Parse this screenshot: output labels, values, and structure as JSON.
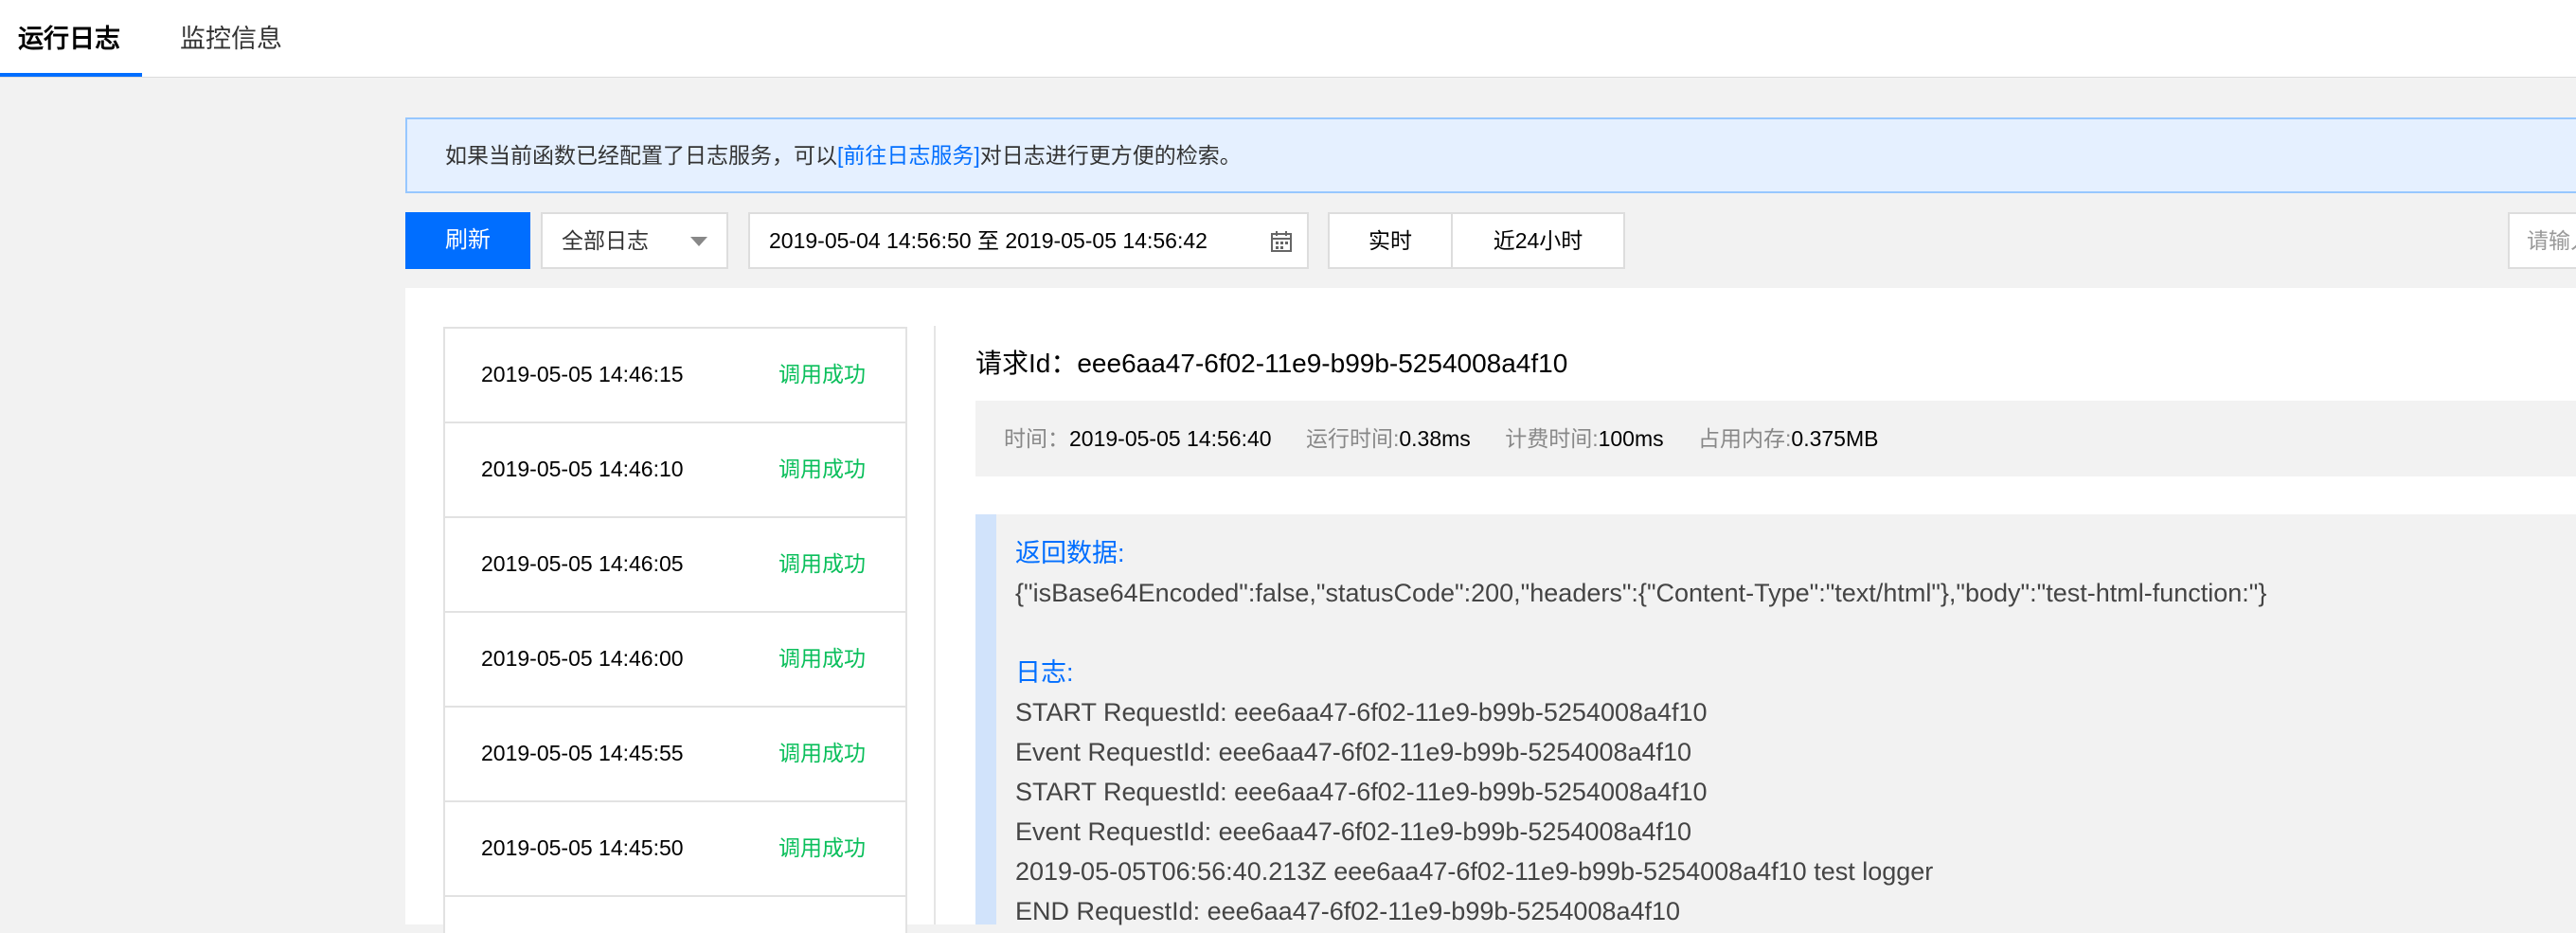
{
  "tabs": [
    {
      "label": "运行日志",
      "active": true
    },
    {
      "label": "监控信息",
      "active": false
    }
  ],
  "banner": {
    "prefix": "如果当前函数已经配置了日志服务，可以",
    "link": "[前往日志服务]",
    "suffix": "对日志进行更方便的检索。"
  },
  "toolbar": {
    "refresh_label": "刷新",
    "log_filter": "全部日志",
    "date_range": "2019-05-04 14:56:50 至 2019-05-05 14:56:42",
    "realtime_label": "实时",
    "last24h_label": "近24小时",
    "search_placeholder": "请输入"
  },
  "log_list": [
    {
      "time": "2019-05-05 14:46:15",
      "status": "调用成功"
    },
    {
      "time": "2019-05-05 14:46:10",
      "status": "调用成功"
    },
    {
      "time": "2019-05-05 14:46:05",
      "status": "调用成功"
    },
    {
      "time": "2019-05-05 14:46:00",
      "status": "调用成功"
    },
    {
      "time": "2019-05-05 14:45:55",
      "status": "调用成功"
    },
    {
      "time": "2019-05-05 14:45:50",
      "status": "调用成功"
    }
  ],
  "detail": {
    "request_label": "请求Id：",
    "request_id": "eee6aa47-6f02-11e9-b99b-5254008a4f10",
    "meta": {
      "time_label": "时间：",
      "time_value": "2019-05-05 14:56:40",
      "run_label": "运行时间:",
      "run_value": "0.38ms",
      "bill_label": "计费时间:",
      "bill_value": "100ms",
      "mem_label": "占用内存:",
      "mem_value": "0.375MB"
    },
    "return_label": "返回数据:",
    "return_value": "{\"isBase64Encoded\":false,\"statusCode\":200,\"headers\":{\"Content-Type\":\"text/html\"},\"body\":\"test-html-function:\"}",
    "log_label": "日志:",
    "log_lines": [
      "START RequestId: eee6aa47-6f02-11e9-b99b-5254008a4f10",
      "Event RequestId: eee6aa47-6f02-11e9-b99b-5254008a4f10",
      "START RequestId: eee6aa47-6f02-11e9-b99b-5254008a4f10",
      "Event RequestId: eee6aa47-6f02-11e9-b99b-5254008a4f10",
      "2019-05-05T06:56:40.213Z eee6aa47-6f02-11e9-b99b-5254008a4f10 test logger",
      "END RequestId: eee6aa47-6f02-11e9-b99b-5254008a4f10"
    ]
  },
  "colors": {
    "accent": "#006eff",
    "success": "#0abf5b",
    "banner_bg": "#e5f0ff"
  }
}
